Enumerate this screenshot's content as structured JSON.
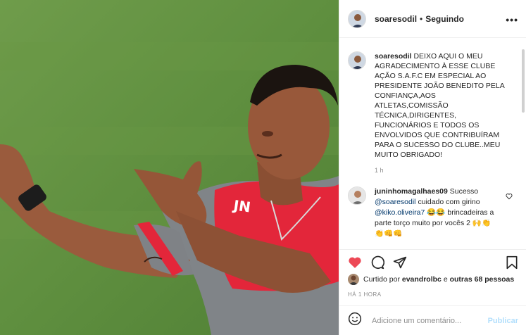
{
  "post": {
    "author": "soaresodil",
    "follow_status": "Seguindo",
    "more_label": "•••",
    "caption_text": "DEIXO AQUI O MEU AGRADECIMENTO À ESSE CLUBE AÇÃO S.A.F.C EM ESPECIAL AO PRESIDENTE JOÃO BENEDITO PELA CONFIANÇA,AOS ATLETAS,COMISSÃO TÉCNICA,DIRIGENTES, FUNCIONÁRIOS E TODOS OS ENVOLVIDOS QUE CONTRIBUÍRAM PARA O SUCESSO DO CLUBE..MEU MUITO OBRIGADO!",
    "caption_age": "1 h",
    "jersey_text": "JN"
  },
  "comment": {
    "author": "juninhomagalhaes09",
    "part1": "Sucesso",
    "mention1": "@soaresodil",
    "part2": "cuidado com girino",
    "mention2": "@kiko.oliveira7",
    "emoji1": "😂😂",
    "part3": "brincadeiras a parte torço muito por vocês 2",
    "emoji2": "🙌👏👏👊👊"
  },
  "likes": {
    "prefix": "Curtido por",
    "user": "evandrolbc",
    "middle": "e",
    "others": "outras 68 pessoas"
  },
  "post_time": "HÁ 1 HORA",
  "add_comment": {
    "placeholder": "Adicione um comentário...",
    "publish_label": "Publicar"
  },
  "colors": {
    "like_red": "#ed4956",
    "link_blue": "#00376b",
    "publish_disabled": "#b2dffc"
  }
}
